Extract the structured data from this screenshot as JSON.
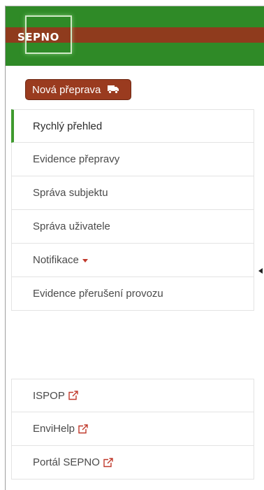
{
  "header": {
    "logo_text": "SEPNO",
    "brand_green": "#2f8a27",
    "brand_brown": "#8f3b1d"
  },
  "new_transport": {
    "label": "Nová přeprava",
    "icon": "truck-icon",
    "color": "#9a3b1f"
  },
  "menu": {
    "items": [
      {
        "label": "Rychlý přehled",
        "active": true
      },
      {
        "label": "Evidence přepravy"
      },
      {
        "label": "Správa subjektu"
      },
      {
        "label": "Správa uživatele"
      },
      {
        "label": "Notifikace",
        "dropdown": true
      },
      {
        "label": "Evidence přerušení provozu"
      }
    ]
  },
  "external_links": [
    {
      "label": "ISPOP",
      "icon": "external-link-icon"
    },
    {
      "label": "EnviHelp",
      "icon": "external-link-icon"
    },
    {
      "label": "Portál SEPNO",
      "icon": "external-link-icon"
    }
  ],
  "sidebar_toggle_icon": "caret-left-icon"
}
